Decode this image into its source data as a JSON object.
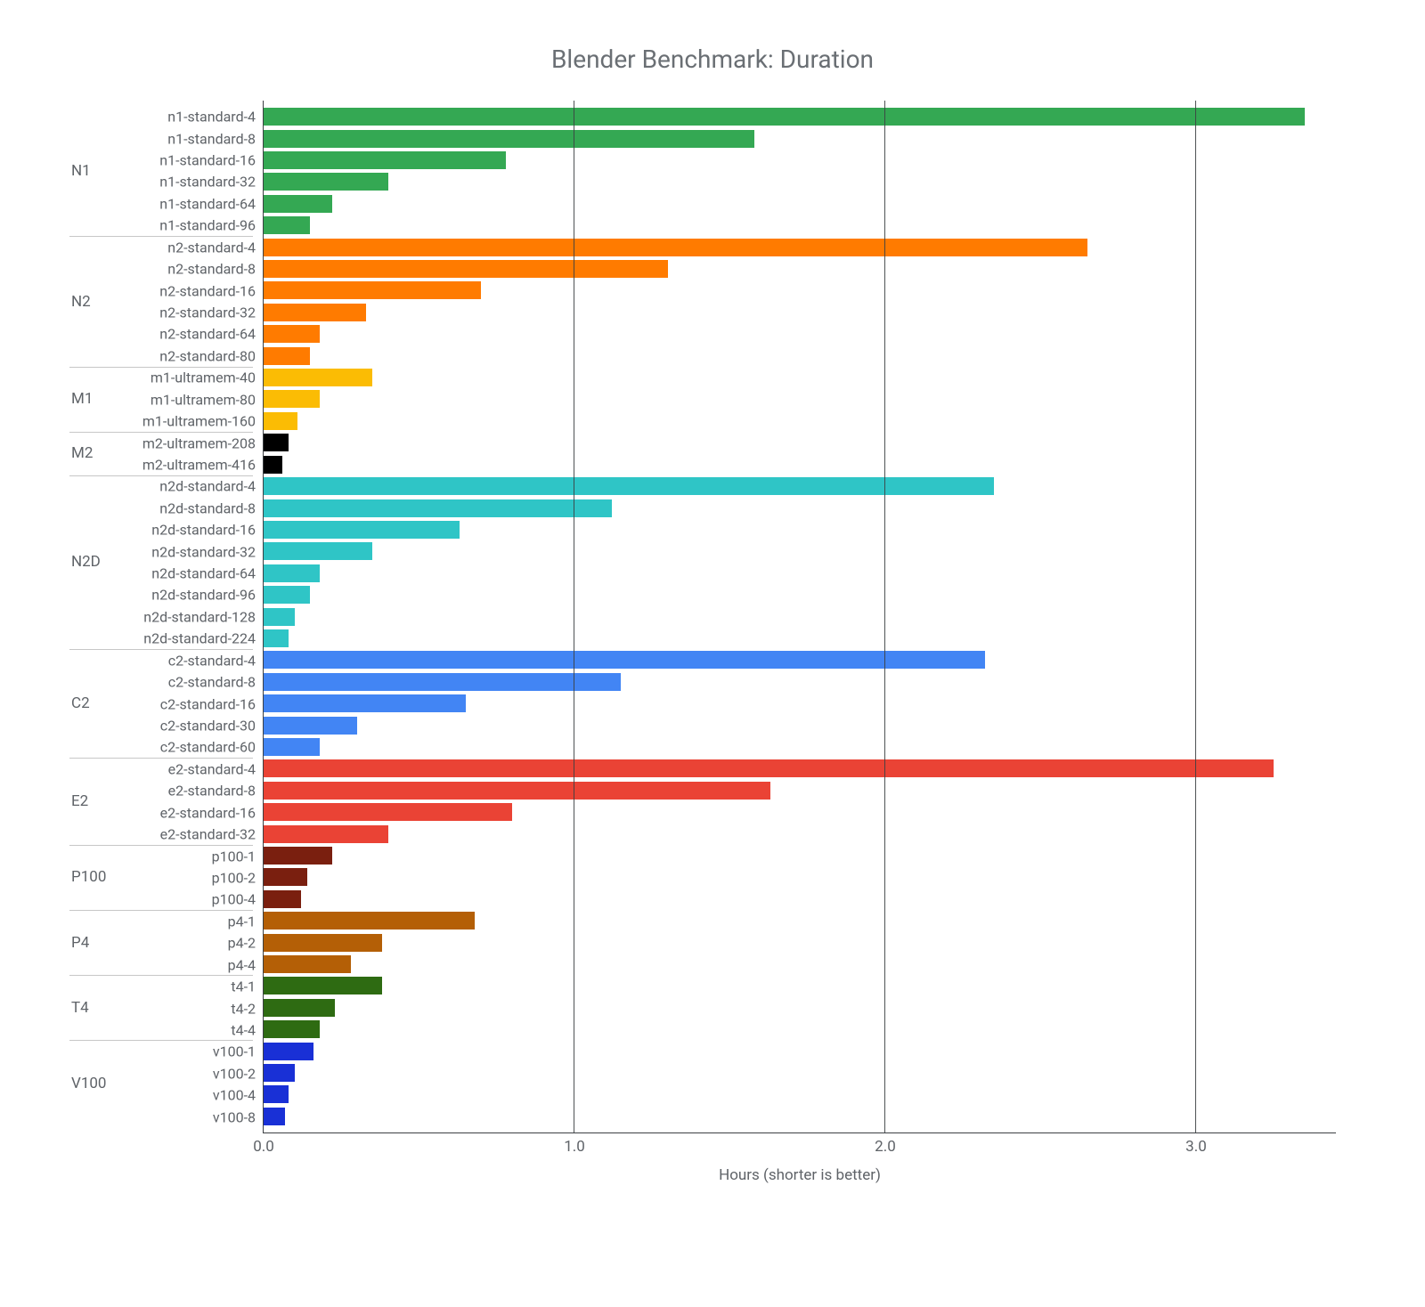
{
  "chart_data": {
    "type": "bar",
    "orientation": "horizontal",
    "title": "Blender Benchmark: Duration",
    "xlabel": "Hours (shorter is better)",
    "ylabel": "",
    "xlim": [
      0.0,
      3.45
    ],
    "x_ticks": [
      0.0,
      1.0,
      2.0,
      3.0
    ],
    "x_tick_labels": [
      "0.0",
      "1.0",
      "2.0",
      "3.0"
    ],
    "groups": [
      {
        "name": "N1",
        "color": "#34a853",
        "items": [
          {
            "label": "n1-standard-4",
            "value": 3.35
          },
          {
            "label": "n1-standard-8",
            "value": 1.58
          },
          {
            "label": "n1-standard-16",
            "value": 0.78
          },
          {
            "label": "n1-standard-32",
            "value": 0.4
          },
          {
            "label": "n1-standard-64",
            "value": 0.22
          },
          {
            "label": "n1-standard-96",
            "value": 0.15
          }
        ]
      },
      {
        "name": "N2",
        "color": "#ff7b00",
        "items": [
          {
            "label": "n2-standard-4",
            "value": 2.65
          },
          {
            "label": "n2-standard-8",
            "value": 1.3
          },
          {
            "label": "n2-standard-16",
            "value": 0.7
          },
          {
            "label": "n2-standard-32",
            "value": 0.33
          },
          {
            "label": "n2-standard-64",
            "value": 0.18
          },
          {
            "label": "n2-standard-80",
            "value": 0.15
          }
        ]
      },
      {
        "name": "M1",
        "color": "#fbbc04",
        "items": [
          {
            "label": "m1-ultramem-40",
            "value": 0.35
          },
          {
            "label": "m1-ultramem-80",
            "value": 0.18
          },
          {
            "label": "m1-ultramem-160",
            "value": 0.11
          }
        ]
      },
      {
        "name": "M2",
        "color": "#000000",
        "items": [
          {
            "label": "m2-ultramem-208",
            "value": 0.08
          },
          {
            "label": "m2-ultramem-416",
            "value": 0.06
          }
        ]
      },
      {
        "name": "N2D",
        "color": "#2fc5c6",
        "items": [
          {
            "label": "n2d-standard-4",
            "value": 2.35
          },
          {
            "label": "n2d-standard-8",
            "value": 1.12
          },
          {
            "label": "n2d-standard-16",
            "value": 0.63
          },
          {
            "label": "n2d-standard-32",
            "value": 0.35
          },
          {
            "label": "n2d-standard-64",
            "value": 0.18
          },
          {
            "label": "n2d-standard-96",
            "value": 0.15
          },
          {
            "label": "n2d-standard-128",
            "value": 0.1
          },
          {
            "label": "n2d-standard-224",
            "value": 0.08
          }
        ]
      },
      {
        "name": "C2",
        "color": "#4285f4",
        "items": [
          {
            "label": "c2-standard-4",
            "value": 2.32
          },
          {
            "label": "c2-standard-8",
            "value": 1.15
          },
          {
            "label": "c2-standard-16",
            "value": 0.65
          },
          {
            "label": "c2-standard-30",
            "value": 0.3
          },
          {
            "label": "c2-standard-60",
            "value": 0.18
          }
        ]
      },
      {
        "name": "E2",
        "color": "#ea4335",
        "items": [
          {
            "label": "e2-standard-4",
            "value": 3.25
          },
          {
            "label": "e2-standard-8",
            "value": 1.63
          },
          {
            "label": "e2-standard-16",
            "value": 0.8
          },
          {
            "label": "e2-standard-32",
            "value": 0.4
          }
        ]
      },
      {
        "name": "P100",
        "color": "#7a1f0f",
        "items": [
          {
            "label": "p100-1",
            "value": 0.22
          },
          {
            "label": "p100-2",
            "value": 0.14
          },
          {
            "label": "p100-4",
            "value": 0.12
          }
        ]
      },
      {
        "name": "P4",
        "color": "#b45f06",
        "items": [
          {
            "label": "p4-1",
            "value": 0.68
          },
          {
            "label": "p4-2",
            "value": 0.38
          },
          {
            "label": "p4-4",
            "value": 0.28
          }
        ]
      },
      {
        "name": "T4",
        "color": "#2e6b12",
        "items": [
          {
            "label": "t4-1",
            "value": 0.38
          },
          {
            "label": "t4-2",
            "value": 0.23
          },
          {
            "label": "t4-4",
            "value": 0.18
          }
        ]
      },
      {
        "name": "V100",
        "color": "#1930d6",
        "items": [
          {
            "label": "v100-1",
            "value": 0.16
          },
          {
            "label": "v100-2",
            "value": 0.1
          },
          {
            "label": "v100-4",
            "value": 0.08
          },
          {
            "label": "v100-8",
            "value": 0.07
          }
        ]
      }
    ]
  }
}
